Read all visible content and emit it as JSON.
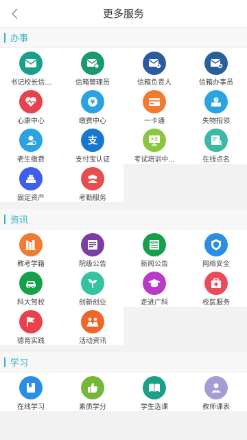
{
  "header": {
    "title": "更多服务"
  },
  "theme": {
    "accent": "#2eb3c9"
  },
  "sections": [
    {
      "title": "办事",
      "items": [
        {
          "label": "书记校长信...",
          "icon": "mail-icon",
          "color": "#1aa089"
        },
        {
          "label": "信箱管理员",
          "icon": "mail-settings-icon",
          "color": "#1a9870"
        },
        {
          "label": "信箱负责人",
          "icon": "mail-person-icon",
          "color": "#2b5aa0"
        },
        {
          "label": "信箱办事员",
          "icon": "mail-clerk-icon",
          "color": "#27609b"
        },
        {
          "label": "心康中心",
          "icon": "heart-pulse-icon",
          "color": "#e8434d"
        },
        {
          "label": "缴费中心",
          "icon": "yen-icon",
          "color": "#2aa3e3"
        },
        {
          "label": "一卡通",
          "icon": "card-icon",
          "color": "#f07b31"
        },
        {
          "label": "失物招领",
          "icon": "lost-found-icon",
          "color": "#2aa3e3"
        },
        {
          "label": "老生缴费",
          "icon": "payment-person-icon",
          "color": "#2aa3e3"
        },
        {
          "label": "支付宝认证",
          "icon": "alipay-icon",
          "color": "#1677d2"
        },
        {
          "label": "考试培训中...",
          "icon": "presentation-icon",
          "color": "#8cc63f"
        },
        {
          "label": "在线点名",
          "icon": "roll-call-icon",
          "color": "#3cb8a4"
        },
        {
          "label": "固定资产",
          "icon": "assets-icon",
          "color": "#3f5fe8"
        },
        {
          "label": "考勤服务",
          "icon": "attendance-icon",
          "color": "#e84c4c"
        }
      ]
    },
    {
      "title": "资讯",
      "items": [
        {
          "label": "教考学籍",
          "icon": "books-icon",
          "color": "#f07b31"
        },
        {
          "label": "院级公告",
          "icon": "notice-icon",
          "color": "#7b3da8"
        },
        {
          "label": "新闻公告",
          "icon": "news-icon",
          "color": "#17a04a"
        },
        {
          "label": "网络安全",
          "icon": "shield-icon",
          "color": "#2a8fe3"
        },
        {
          "label": "科大驾校",
          "icon": "car-icon",
          "color": "#17a04a"
        },
        {
          "label": "创新创业",
          "icon": "sprout-icon",
          "color": "#34c3a1"
        },
        {
          "label": "走进广科",
          "icon": "graduation-cap-icon",
          "color": "#b93ac8"
        },
        {
          "label": "校医服务",
          "icon": "medical-kit-icon",
          "color": "#e84c5c"
        },
        {
          "label": "德育实践",
          "icon": "flag-icon",
          "color": "#e8434d"
        },
        {
          "label": "活动资讯",
          "icon": "people-icon",
          "color": "#f0662a"
        }
      ]
    },
    {
      "title": "学习",
      "items": [
        {
          "label": "在线学习",
          "icon": "book-icon",
          "color": "#2a8fe3"
        },
        {
          "label": "素质学分",
          "icon": "thumb-up-icon",
          "color": "#74b83a"
        },
        {
          "label": "学生选课",
          "icon": "open-book-icon",
          "color": "#1aa089"
        },
        {
          "label": "教师课表",
          "icon": "teacher-icon",
          "color": "#a79bd6"
        }
      ]
    }
  ]
}
